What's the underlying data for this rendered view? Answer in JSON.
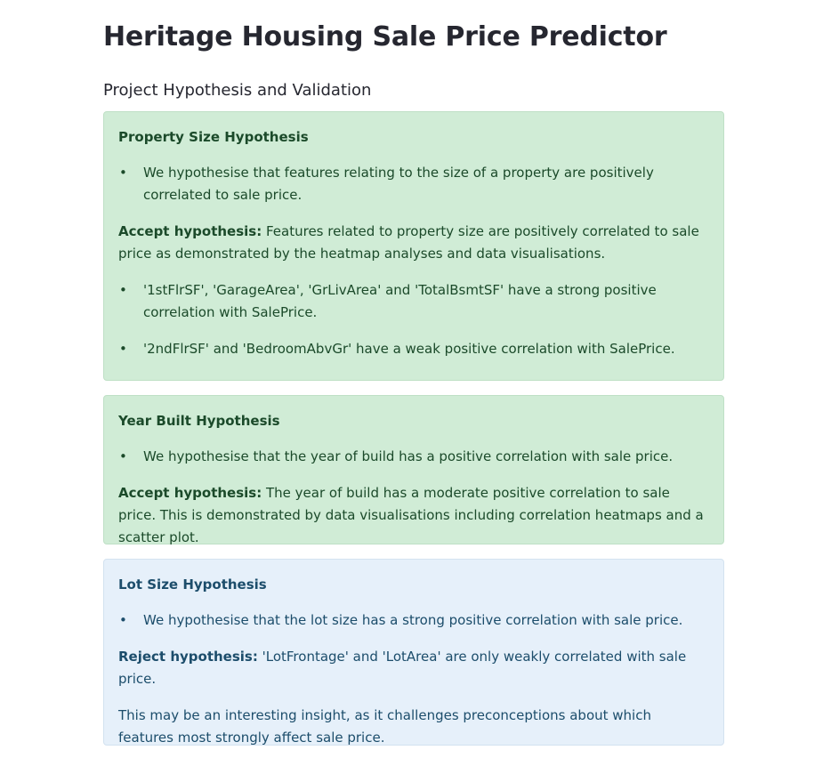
{
  "page": {
    "title": "Heritage Housing Sale Price Predictor",
    "subtitle": "Project Hypothesis and Validation"
  },
  "hypotheses": [
    {
      "title": "Property Size Hypothesis",
      "statement": "We hypothesise that features relating to the size of a property are positively correlated to sale price.",
      "verdict_label": "Accept hypothesis:",
      "verdict_text": " Features related to property size are positively correlated to sale price as demonstrated by the heatmap analyses and data visualisations.",
      "findings": [
        "'1stFlrSF', 'GarageArea', 'GrLivArea' and 'TotalBsmtSF' have a strong positive correlation with SalePrice.",
        "'2ndFlrSF' and 'BedroomAbvGr' have a weak positive correlation with SalePrice."
      ],
      "style": "success"
    },
    {
      "title": "Year Built Hypothesis",
      "statement": "We hypothesise that the year of build has a positive correlation with sale price.",
      "verdict_label": "Accept hypothesis:",
      "verdict_text": " The year of build has a moderate positive correlation to sale price. This is demonstrated by data visualisations including correlation heatmaps and a scatter plot.",
      "style": "success"
    },
    {
      "title": "Lot Size Hypothesis",
      "statement": "We hypothesise that the lot size has a strong positive correlation with sale price.",
      "verdict_label": "Reject hypothesis:",
      "verdict_text": " 'LotFrontage' and 'LotArea' are only weakly correlated with sale price.",
      "note": "This may be an interesting insight, as it challenges preconceptions about which features most strongly affect sale price.",
      "style": "info"
    }
  ],
  "colors": {
    "success_bg": "#d0ecd6",
    "success_text": "#1b4a2a",
    "info_bg": "#e6f0fa",
    "info_text": "#1c4d6b"
  }
}
